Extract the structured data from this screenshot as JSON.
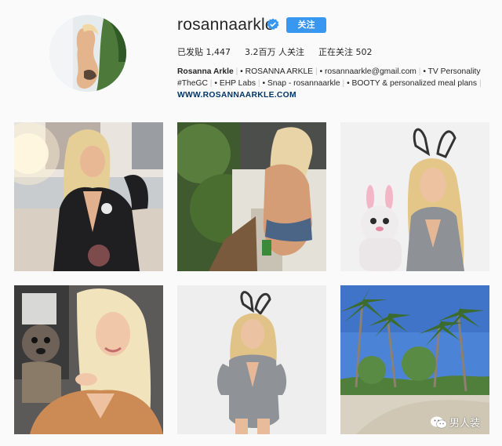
{
  "profile": {
    "username": "rosannaarkle",
    "follow_label": "关注",
    "verified_icon": "verified-badge-icon",
    "stats": {
      "posts_label": "已发贴",
      "posts_value": "1,447",
      "followers_value": "3.2百万",
      "followers_label": "人关注",
      "following_label": "正在关注",
      "following_value": "502"
    },
    "bio": {
      "name": "Rosanna Arkle",
      "line1": [
        "• ROSANNA ARKLE",
        "• rosannaarkle@gmail.com",
        "• TV Personality"
      ],
      "line2": [
        "#TheGC",
        "• EHP Labs",
        "• Snap - rosannaarkle",
        "• BOOTY & personalized meal plans"
      ],
      "separator": "|"
    },
    "website": "WWW.ROSANNAARKLE.COM"
  },
  "posts": [
    {
      "label": "post-1"
    },
    {
      "label": "post-2"
    },
    {
      "label": "post-3"
    },
    {
      "label": "post-4"
    },
    {
      "label": "post-5"
    },
    {
      "label": "post-6"
    }
  ],
  "watermark": {
    "text": "男人装",
    "icon": "wechat-icon"
  },
  "colors": {
    "accent": "#3897f0",
    "link": "#003569",
    "background": "#fafafa"
  }
}
